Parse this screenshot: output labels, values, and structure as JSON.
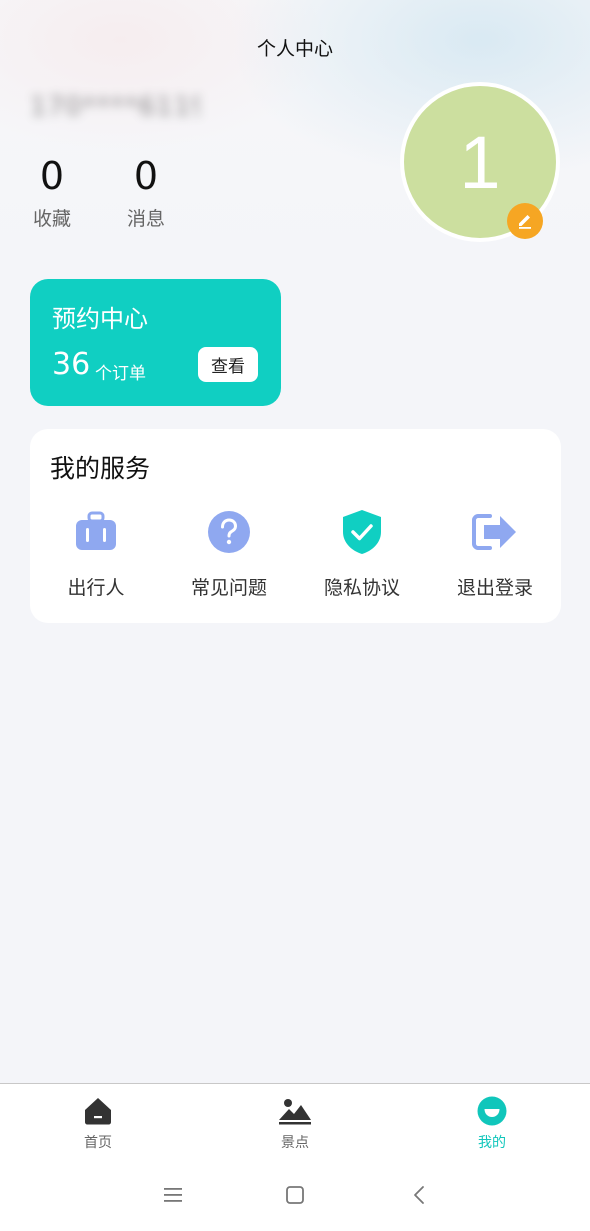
{
  "header": {
    "title": "个人中心"
  },
  "user": {
    "name_masked": "170****6119",
    "avatar_text": "1",
    "stats": [
      {
        "value": "0",
        "label": "收藏"
      },
      {
        "value": "0",
        "label": "消息"
      }
    ]
  },
  "booking": {
    "title": "预约中心",
    "count": "36",
    "unit": "个订单",
    "view_label": "查看"
  },
  "services": {
    "title": "我的服务",
    "items": [
      {
        "label": "出行人",
        "icon": "suitcase-icon"
      },
      {
        "label": "常见问题",
        "icon": "question-icon"
      },
      {
        "label": "隐私协议",
        "icon": "shield-check-icon"
      },
      {
        "label": "退出登录",
        "icon": "logout-icon"
      }
    ]
  },
  "tabbar": {
    "items": [
      {
        "label": "首页",
        "icon": "home-icon"
      },
      {
        "label": "景点",
        "icon": "mountain-icon"
      },
      {
        "label": "我的",
        "icon": "profile-smile-icon",
        "active": true
      }
    ]
  },
  "colors": {
    "accent": "#10cfc2",
    "avatar_bg": "#ccdf9f",
    "edit_badge": "#f6a623",
    "service_icon": "#8fa8f0"
  }
}
